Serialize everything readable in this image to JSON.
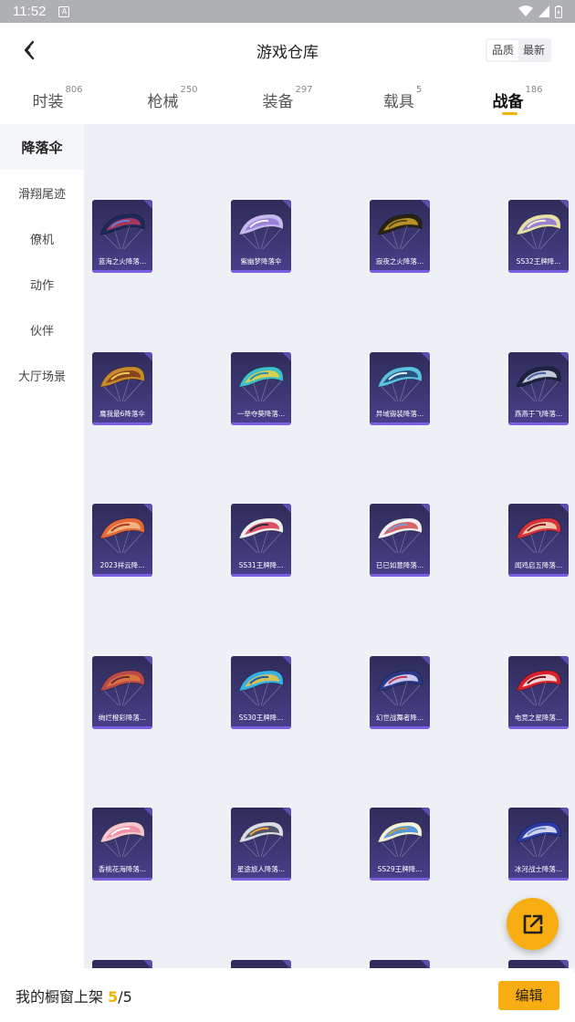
{
  "status_bar": {
    "time": "11:52",
    "app_icon": "A"
  },
  "header": {
    "title": "游戏仓库",
    "sort_options": [
      "品质",
      "最新"
    ],
    "sort_active": "品质"
  },
  "tabs": [
    {
      "label": "时装",
      "count": "806"
    },
    {
      "label": "枪械",
      "count": "250"
    },
    {
      "label": "装备",
      "count": "297"
    },
    {
      "label": "载具",
      "count": "5"
    },
    {
      "label": "战备",
      "count": "186"
    }
  ],
  "active_tab": "战备",
  "sidebar": {
    "active": "降落伞",
    "items": [
      "滑翔尾迹",
      "僚机",
      "动作",
      "伙伴",
      "大厅场景"
    ]
  },
  "items": [
    {
      "name": "蓝海之火降落...",
      "colors": [
        "#1b2a5a",
        "#c0395b",
        "#6a7ad8"
      ]
    },
    {
      "name": "紫幽梦降落伞",
      "colors": [
        "#c7b9f0",
        "#8f78d8",
        "#f5f0ff"
      ]
    },
    {
      "name": "寂夜之火降落...",
      "colors": [
        "#2a2410",
        "#d4a52a",
        "#5c4a1c"
      ]
    },
    {
      "name": "SS32王牌降...",
      "colors": [
        "#e6dfa8",
        "#8b6fd6",
        "#f4efd0"
      ]
    },
    {
      "name": "鹰我最6降落伞",
      "colors": [
        "#c98a2a",
        "#7a3a1a",
        "#f2c95a"
      ]
    },
    {
      "name": "一举夺葵降落...",
      "colors": [
        "#3fbfc7",
        "#f2d23a",
        "#2b8fb0"
      ]
    },
    {
      "name": "异域锻装降落...",
      "colors": [
        "#5cc0e0",
        "#1f3f6f",
        "#d8f0f8"
      ]
    },
    {
      "name": "燕燕于飞降落...",
      "colors": [
        "#1e2340",
        "#e0e6f5",
        "#4a5aa8"
      ]
    },
    {
      "name": "2023祥云降...",
      "colors": [
        "#e36a3a",
        "#f2c08a",
        "#a83a20"
      ]
    },
    {
      "name": "SS31王牌降...",
      "colors": [
        "#f0f0f0",
        "#d8344a",
        "#2a2a3a"
      ]
    },
    {
      "name": "已已如意降落...",
      "colors": [
        "#f0f0f5",
        "#d84a4a",
        "#7a9ad8"
      ]
    },
    {
      "name": "闻鸡启五降落...",
      "colors": [
        "#d8323a",
        "#f5e0c0",
        "#8a1a20"
      ]
    },
    {
      "name": "绚烂橙彩降落...",
      "colors": [
        "#b84a4a",
        "#e07a3a",
        "#6a2a3a"
      ]
    },
    {
      "name": "SS30王牌降...",
      "colors": [
        "#3ab0e8",
        "#f2c43a",
        "#1a5aa8"
      ]
    },
    {
      "name": "幻世战舞者降...",
      "colors": [
        "#2a3a8a",
        "#e8e0ff",
        "#c03a5a"
      ]
    },
    {
      "name": "电竞之星降落...",
      "colors": [
        "#d8202a",
        "#f5f5f5",
        "#7a0a10"
      ]
    },
    {
      "name": "香桃花海降落...",
      "colors": [
        "#f5c8d0",
        "#f08aa0",
        "#ffffff"
      ]
    },
    {
      "name": "星途旅人降落...",
      "colors": [
        "#d8dde8",
        "#3a4050",
        "#f2a43a"
      ]
    },
    {
      "name": "SS29王牌降...",
      "colors": [
        "#f5f0d8",
        "#3a8ad8",
        "#c89a3a"
      ]
    },
    {
      "name": "冰河战士降落...",
      "colors": [
        "#2a3aa8",
        "#f0f0f8",
        "#6a8ad8"
      ]
    },
    {
      "name": "",
      "colors": [
        "#2f2c5a",
        "#3d3876",
        "#4a3f8c"
      ]
    },
    {
      "name": "",
      "colors": [
        "#2f2c5a",
        "#3d3876",
        "#4a3f8c"
      ]
    },
    {
      "name": "",
      "colors": [
        "#2f2c5a",
        "#3d3876",
        "#4a3f8c"
      ]
    },
    {
      "name": "",
      "colors": [
        "#2f2c5a",
        "#3d3876",
        "#4a3f8c"
      ]
    }
  ],
  "bottom_bar": {
    "label": "我的橱窗上架",
    "current": "5",
    "separator": "/",
    "total": "5",
    "edit_label": "编辑"
  },
  "theme": {
    "accent": "#f8ad13",
    "card_bg": "#3d3876"
  }
}
